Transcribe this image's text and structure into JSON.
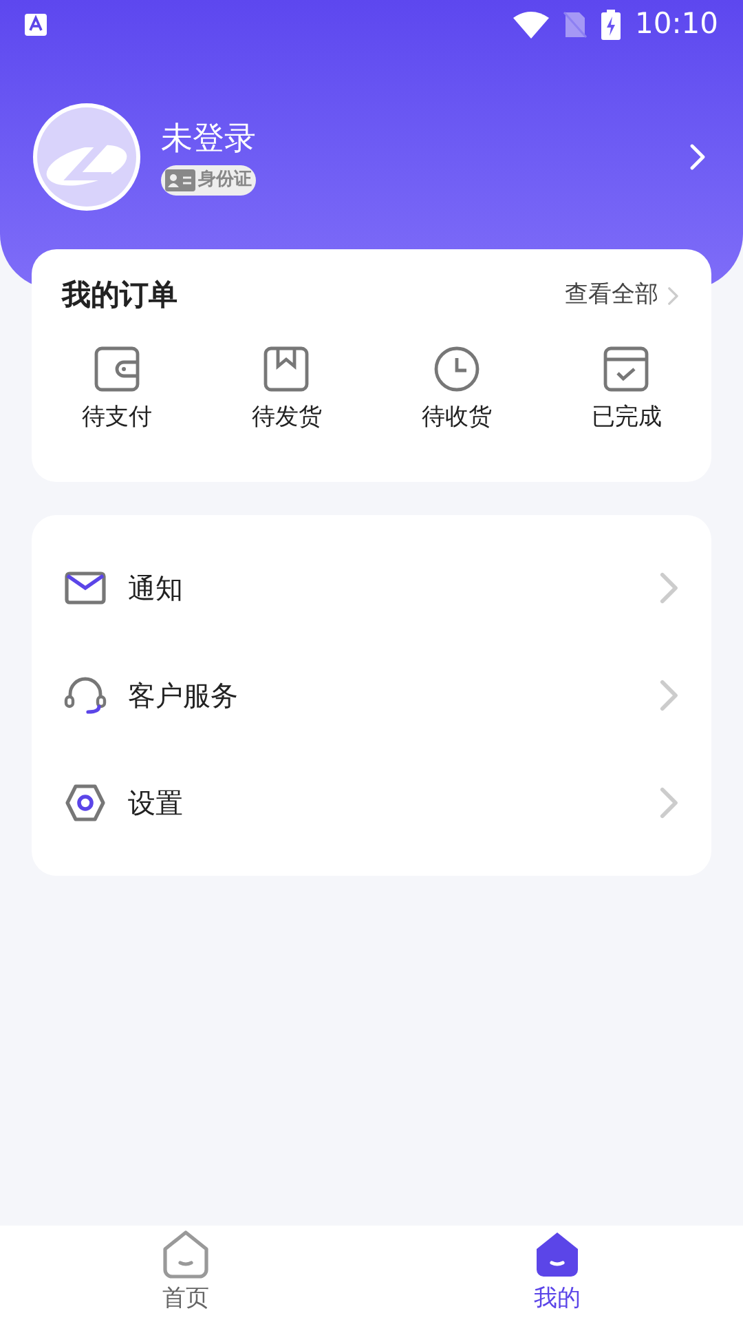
{
  "status_bar": {
    "time": "10:10"
  },
  "profile": {
    "name": "未登录",
    "badge": "身份证"
  },
  "orders": {
    "title": "我的订单",
    "view_all": "查看全部",
    "items": [
      {
        "kind": "wallet",
        "label": "待支付"
      },
      {
        "kind": "box",
        "label": "待发货"
      },
      {
        "kind": "clock",
        "label": "待收货"
      },
      {
        "kind": "calendar",
        "label": "已完成"
      }
    ]
  },
  "menu": [
    {
      "kind": "mail",
      "label": "通知"
    },
    {
      "kind": "headset",
      "label": "客户服务"
    },
    {
      "kind": "settings",
      "label": "设置"
    }
  ],
  "tabs": [
    {
      "kind": "home",
      "label": "首页",
      "selected": false
    },
    {
      "kind": "me",
      "label": "我的",
      "selected": true
    }
  ]
}
